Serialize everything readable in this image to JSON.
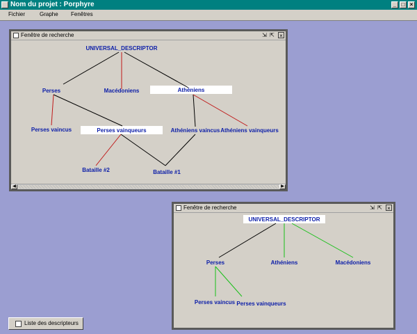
{
  "window": {
    "title": "Nom du projet : Porphyre",
    "controls": {
      "minimize": "_",
      "maximize": "□",
      "close": "×"
    }
  },
  "menu": [
    "Fichier",
    "Graphe",
    "Fenêtres"
  ],
  "colors": {
    "desktop": "#9b9ed1",
    "node_text": "#0b1da8",
    "edge_black": "#000000",
    "edge_red": "#c01818",
    "edge_green": "#19c019"
  },
  "frame1": {
    "title": "Fenêtre de recherche",
    "buttons": {
      "restore": "⇲",
      "maximize": "⇱",
      "close": "×"
    },
    "nodes": {
      "root": "UNIVERSAL_DESCRIPTOR",
      "perses": "Perses",
      "macedoniens": "Macédoniens",
      "atheniens": "Athéniens",
      "perses_vaincus": "Perses vaincus",
      "perses_vainqueurs": "Perses vainqueurs",
      "atheniens_vaincus": "Athéniens vaincus",
      "atheniens_vainqueurs": "Athéniens vainqueurs",
      "bataille2": "Bataille #2",
      "bataille1": "Bataille #1"
    }
  },
  "frame2": {
    "title": "Fenêtre de recherche",
    "buttons": {
      "restore": "⇲",
      "maximize": "⇱",
      "close": "×"
    },
    "nodes": {
      "root": "UNIVERSAL_DESCRIPTOR",
      "perses": "Perses",
      "atheniens": "Athéniens",
      "macedoniens": "Macédoniens",
      "perses_vaincus": "Perses vaincus",
      "perses_vainqueurs": "Perses vainqueurs"
    }
  },
  "taskbar": {
    "label": "Liste des descripteurs"
  }
}
